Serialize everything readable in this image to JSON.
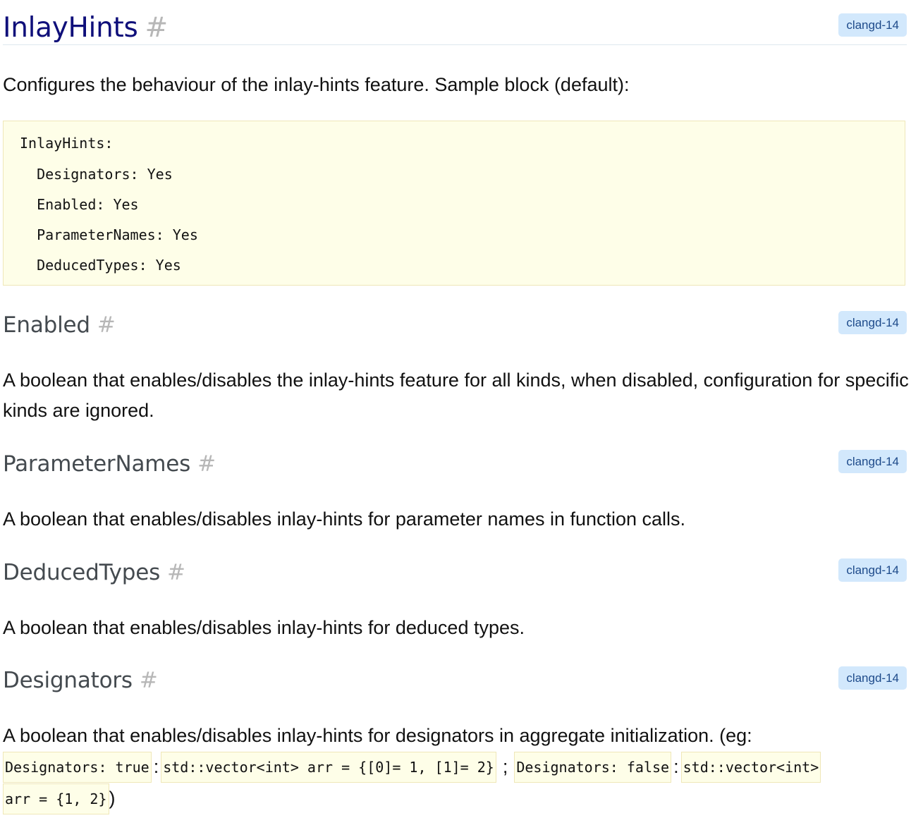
{
  "sections": {
    "inlay_hints": {
      "title": "InlayHints",
      "anchor": "#",
      "badge": "clangd-14",
      "description": "Configures the behaviour of the inlay-hints feature. Sample block (default):",
      "code_lines": [
        "InlayHints:",
        "  Designators: Yes",
        "  Enabled: Yes",
        "  ParameterNames: Yes",
        "  DeducedTypes: Yes"
      ]
    },
    "enabled": {
      "title": "Enabled",
      "anchor": "#",
      "badge": "clangd-14",
      "description": "A boolean that enables/disables the inlay-hints feature for all kinds, when disabled, configuration for specific kinds are ignored."
    },
    "parameter_names": {
      "title": "ParameterNames",
      "anchor": "#",
      "badge": "clangd-14",
      "description": "A boolean that enables/disables inlay-hints for parameter names in function calls."
    },
    "deduced_types": {
      "title": "DeducedTypes",
      "anchor": "#",
      "badge": "clangd-14",
      "description": "A boolean that enables/disables inlay-hints for deduced types."
    },
    "designators": {
      "title": "Designators",
      "anchor": "#",
      "badge": "clangd-14",
      "description": "A boolean that enables/disables inlay-hints for designators in aggregate initialization. (eg:",
      "example": {
        "code1": "Designators: true",
        "sep1": ":",
        "code2": "std::vector<int> arr = {[0]= 1, [1]= 2}",
        "sep2": ";",
        "code3": "Designators: false",
        "sep3": ":",
        "code4_part1": "std::vector<int>",
        "code4_part2": "arr = {1, 2}",
        "closing": ")"
      }
    }
  },
  "colors": {
    "title": "#0f0f7a",
    "subheading": "#444a4f",
    "badge_bg": "#d2e8fc",
    "badge_text": "#1d4a8a",
    "code_bg": "#fefee8"
  }
}
